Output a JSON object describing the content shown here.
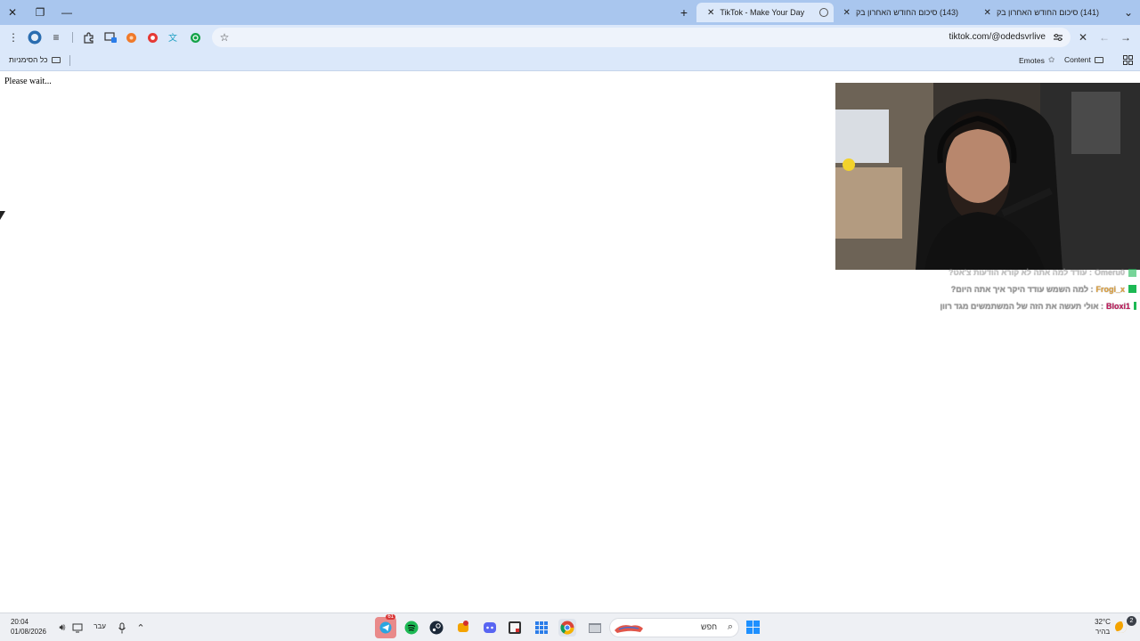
{
  "browser": {
    "tabs": [
      {
        "title": "(141) סיכום החודש האחרון בק",
        "favicon": "youtube-icon"
      },
      {
        "title": "(143) סיכום החודש האחרון בק",
        "favicon": "youtube-icon"
      },
      {
        "title": "TikTok - Make Your Day",
        "favicon": "tiktok-loading-icon",
        "active": true
      }
    ],
    "url": "tiktok.com/@odedsvrlive",
    "bookmarks": {
      "all_bookmarks_label": "כל הסימניות",
      "emotes_label": "Emotes",
      "content_label": "Content"
    }
  },
  "page": {
    "status_text": "Please wait..."
  },
  "stream_chat": [
    {
      "user": "Omeru0",
      "user_color": "#9a9a9a",
      "message": "עודד למה אתה לא קורא הודעות צ'אט?"
    },
    {
      "user": "Frogi_x",
      "user_color": "#e3a33c",
      "message": "למה השמש עודד היקר איך אתה היום?"
    },
    {
      "user": "Bloxi1",
      "user_color": "#c2185b",
      "message": "אולי תעשה את הזה של המשתמשים מגד רוון"
    }
  ],
  "taskbar": {
    "time": "20:04",
    "date": "01/08/2026",
    "language": "עבר",
    "search_placeholder": "חפש",
    "weather_temp": "32°C",
    "weather_desc": "בהיר",
    "notification_count": "2",
    "telegram_badge": "61"
  },
  "colors": {
    "tab_strip": "#a9c6ee",
    "toolbar": "#dbe8fa",
    "taskbar": "#eef0f4"
  }
}
